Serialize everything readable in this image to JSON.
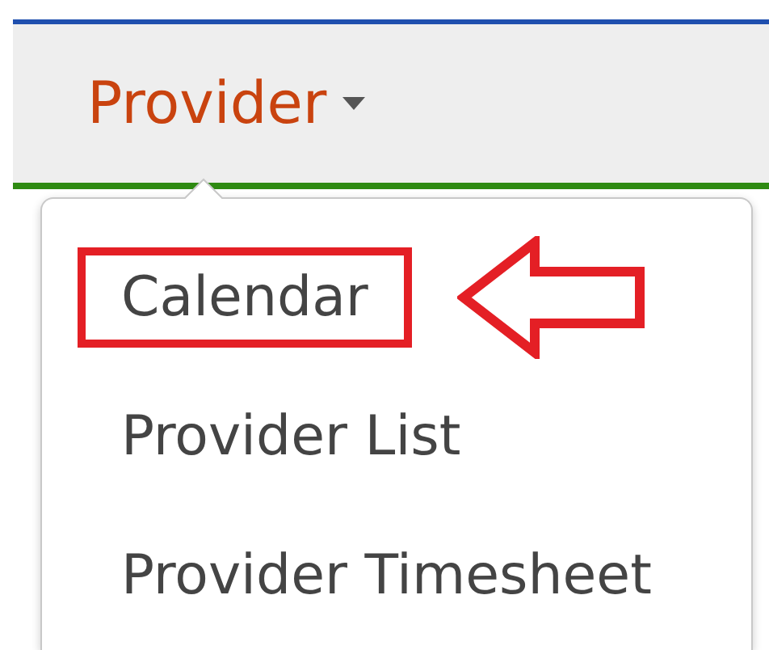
{
  "navbar": {
    "menu_label": "Provider"
  },
  "menu": {
    "items": [
      {
        "label": "Calendar",
        "highlighted": true
      },
      {
        "label": "Provider List",
        "highlighted": false
      },
      {
        "label": "Provider Timesheet",
        "highlighted": false
      }
    ]
  }
}
